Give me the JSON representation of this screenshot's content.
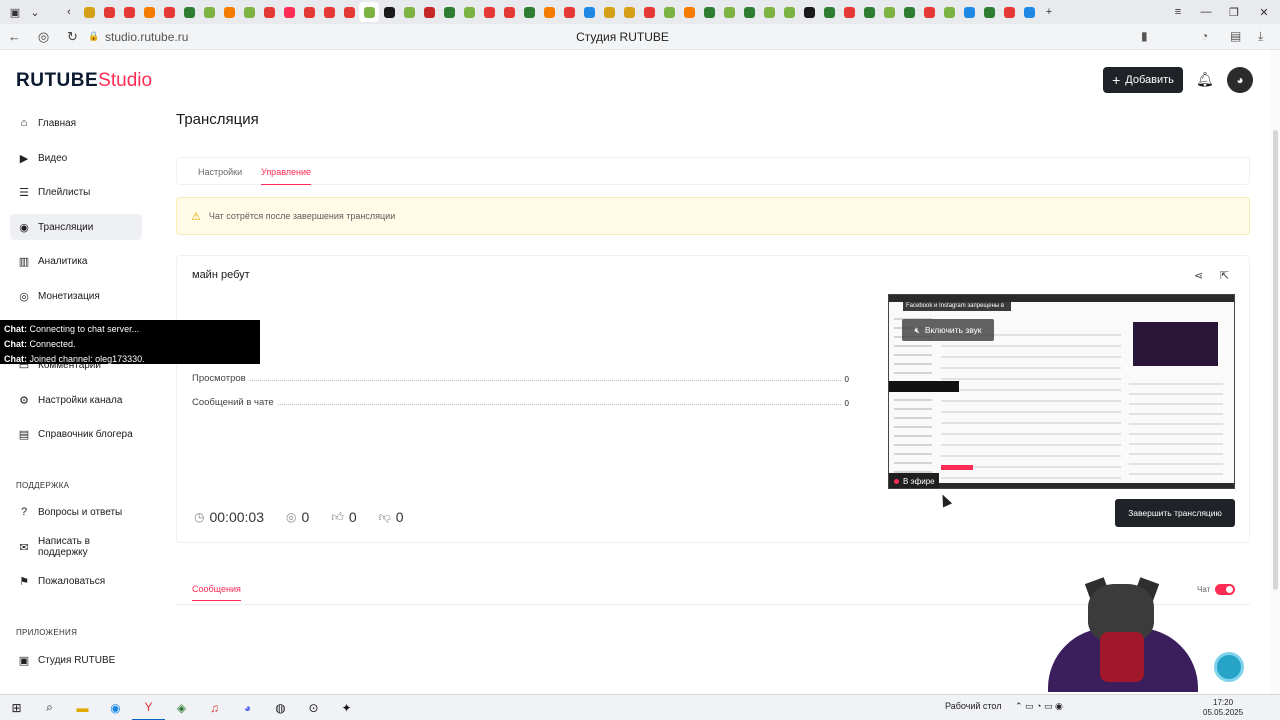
{
  "browser": {
    "url": "studio.rutube.ru",
    "page_title": "Студия RUTUBE",
    "tab_colors": [
      "#d4a017",
      "#e53935",
      "#e53935",
      "#f57c00",
      "#e53935",
      "#2e7d32",
      "#7cb342",
      "#f57c00",
      "#7cb342",
      "#e53935",
      "#ff2d55",
      "#e53935",
      "#e53935",
      "#e53935",
      "#7cb342",
      "#1a1a1a",
      "#7cb342",
      "#c62828",
      "#2e7d32",
      "#7cb342",
      "#e53935",
      "#e53935",
      "#2e7d32",
      "#f57c00",
      "#e53935",
      "#1e88e5",
      "#d4a017",
      "#d4a017",
      "#e53935",
      "#7cb342",
      "#f57c00",
      "#2e7d32",
      "#7cb342",
      "#2e7d32",
      "#7cb342",
      "#7cb342",
      "#1a1a1a",
      "#2e7d32",
      "#e53935",
      "#2e7d32",
      "#7cb342",
      "#2e7d32",
      "#e53935",
      "#7cb342",
      "#1e88e5",
      "#2e7d32",
      "#e53935",
      "#1e88e5"
    ]
  },
  "header": {
    "logo_main": "RUTUBE",
    "logo_studio": "Studio",
    "add_button": "Добавить"
  },
  "sidebar": {
    "items": [
      {
        "label": "Главная",
        "icon": "home-icon"
      },
      {
        "label": "Видео",
        "icon": "video-icon"
      },
      {
        "label": "Плейлисты",
        "icon": "playlist-icon"
      },
      {
        "label": "Трансляции",
        "icon": "broadcast-icon",
        "active": true
      },
      {
        "label": "Аналитика",
        "icon": "analytics-icon"
      },
      {
        "label": "Монетизация",
        "icon": "monetization-icon"
      },
      {
        "label": "Комментарии",
        "icon": "comments-icon"
      },
      {
        "label": "Настройки канала",
        "icon": "settings-icon"
      },
      {
        "label": "Справочник блогера",
        "icon": "book-icon"
      }
    ],
    "support_title": "ПОДДЕРЖКА",
    "support_items": [
      {
        "label": "Вопросы и ответы",
        "icon": "faq-icon"
      },
      {
        "label": "Написать в поддержку",
        "icon": "mail-icon"
      },
      {
        "label": "Пожаловаться",
        "icon": "flag-icon"
      }
    ],
    "apps_title": "ПРИЛОЖЕНИЯ",
    "app_items": [
      {
        "label": "Студия RUTUBE",
        "icon": "app-icon"
      }
    ]
  },
  "main": {
    "page_title": "Трансляция",
    "tabs": [
      {
        "label": "Настройки"
      },
      {
        "label": "Управление",
        "active": true
      }
    ],
    "warning": "Чат сотрётся после завершения трансляции",
    "stream": {
      "name": "майн ребут",
      "stats": [
        {
          "label": "Просмотров",
          "value": "0"
        },
        {
          "label": "Сообщений в чате",
          "value": "0"
        }
      ],
      "duration": "00:00:03",
      "viewers": "0",
      "likes": "0",
      "dislikes": "0",
      "preview": {
        "banner": "Facebook и Instagram запрещены в РФ",
        "sound_button": "Включить звук",
        "live_badge": "В эфире"
      },
      "end_button": "Завершить трансляцию"
    },
    "messages": {
      "tab": "Сообщения",
      "chat_label": "Чат",
      "chat_enabled": true
    }
  },
  "overlay_chat": [
    {
      "prefix": "Chat:",
      "text": "Connecting to chat server..."
    },
    {
      "prefix": "Chat:",
      "text": "Connected."
    },
    {
      "prefix": "Chat:",
      "text": "Joined channel: oleg173330."
    }
  ],
  "taskbar": {
    "desktop_label": "Рабочий стол",
    "time": "17:20",
    "date": "05.05.2025"
  }
}
